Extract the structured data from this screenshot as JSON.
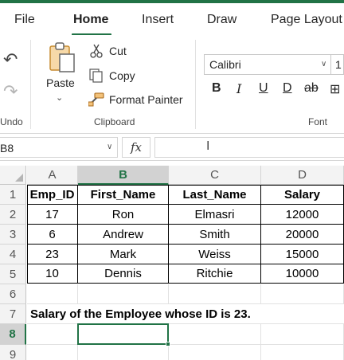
{
  "ribbon_tabs": [
    "File",
    "Home",
    "Insert",
    "Draw",
    "Page Layout"
  ],
  "active_tab": "Home",
  "undo_group": {
    "label": "Undo"
  },
  "clipboard": {
    "paste": "Paste",
    "cut": "Cut",
    "copy": "Copy",
    "format_painter": "Format Painter",
    "label": "Clipboard"
  },
  "font_group": {
    "font_name": "Calibri",
    "font_size": "1",
    "label": "Font",
    "buttons": [
      "B",
      "I",
      "U",
      "D",
      "ab",
      "⊞"
    ]
  },
  "formula_bar": {
    "name_box": "B8",
    "fx": "fx",
    "value": ""
  },
  "sheet": {
    "columns": [
      "A",
      "B",
      "C",
      "D"
    ],
    "selected_column": "B",
    "rows": [
      "1",
      "2",
      "3",
      "4",
      "5",
      "6",
      "7",
      "8",
      "9"
    ],
    "selected_row": "8",
    "table_headers": [
      "Emp_ID",
      "First_Name",
      "Last_Name",
      "Salary"
    ],
    "table_rows": [
      [
        "17",
        "Ron",
        "Elmasri",
        "12000"
      ],
      [
        "6",
        "Andrew",
        "Smith",
        "20000"
      ],
      [
        "23",
        "Mark",
        "Weiss",
        "15000"
      ],
      [
        "10",
        "Dennis",
        "Ritchie",
        "10000"
      ]
    ],
    "note": "Salary of the Employee whose ID is 23."
  },
  "colors": {
    "accent": "#217346",
    "header_bg": "#f3f3f3",
    "selected_header_bg": "#d2d2d2"
  }
}
